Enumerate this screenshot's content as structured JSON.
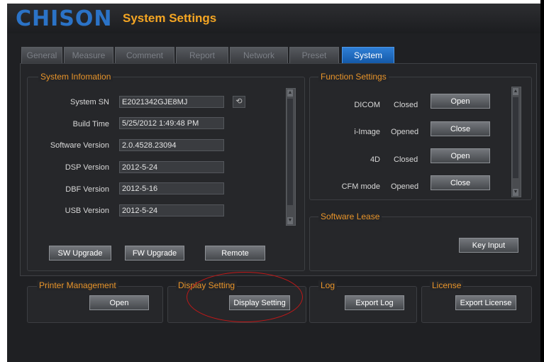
{
  "header": {
    "logo": "CHISON",
    "title": "System Settings"
  },
  "tabs": [
    {
      "label": "General"
    },
    {
      "label": "Measure"
    },
    {
      "label": "Comment"
    },
    {
      "label": "Report"
    },
    {
      "label": "Network"
    },
    {
      "label": "Preset"
    },
    {
      "label": "System",
      "active": true
    }
  ],
  "system_info": {
    "title": "System Infomation",
    "rows": [
      {
        "label": "System SN",
        "value": "E2021342GJE8MJ"
      },
      {
        "label": "Build Time",
        "value": "5/25/2012 1:49:48 PM"
      },
      {
        "label": "Software Version",
        "value": "2.0.4528.23094"
      },
      {
        "label": "DSP Version",
        "value": "2012-5-24"
      },
      {
        "label": "DBF Version",
        "value": "2012-5-16"
      },
      {
        "label": "USB Version",
        "value": "2012-5-24"
      }
    ],
    "refresh_icon": "refresh-icon",
    "buttons": {
      "sw_upgrade": "SW Upgrade",
      "fw_upgrade": "FW Upgrade",
      "remote": "Remote"
    }
  },
  "function_settings": {
    "title": "Function Settings",
    "rows": [
      {
        "label": "DICOM",
        "status": "Closed",
        "action": "Open"
      },
      {
        "label": "i-Image",
        "status": "Opened",
        "action": "Close"
      },
      {
        "label": "4D",
        "status": "Closed",
        "action": "Open"
      },
      {
        "label": "CFM mode",
        "status": "Opened",
        "action": "Close"
      }
    ]
  },
  "software_lease": {
    "title": "Software Lease",
    "key_input": "Key Input"
  },
  "printer": {
    "title": "Printer Management",
    "button": "Open"
  },
  "display": {
    "title": "Display Setting",
    "button": "Display Setting"
  },
  "log": {
    "title": "Log",
    "button": "Export Log"
  },
  "license": {
    "title": "License",
    "button": "Export License"
  },
  "colors": {
    "accent": "#f5a623",
    "active_tab": "#1f6dc2",
    "background": "#1f2023",
    "annotation": "#c01818"
  }
}
